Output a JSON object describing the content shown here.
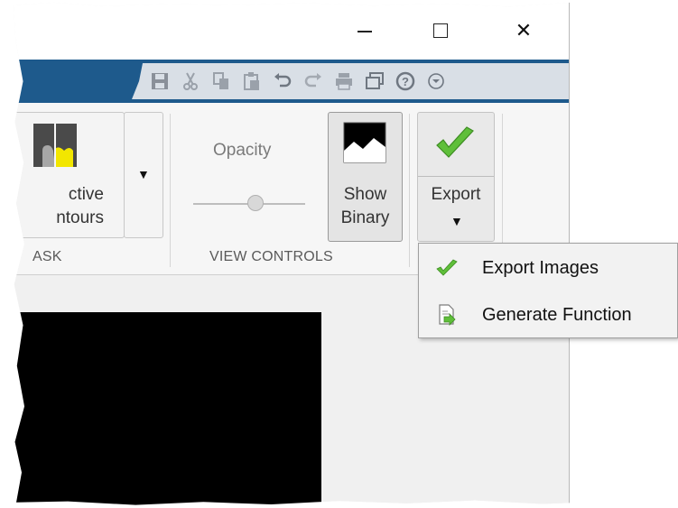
{
  "window": {
    "minimize_label": "—",
    "maximize_label": "☐",
    "close_label": "✕"
  },
  "quick_access": {
    "icons": [
      "save-icon",
      "cut-icon",
      "copy-icon",
      "paste-icon",
      "undo-icon",
      "redo-icon",
      "print-icon",
      "window-icon",
      "help-icon",
      "options-icon"
    ]
  },
  "ribbon": {
    "mask_section": {
      "active_contours_line1": "ctive",
      "active_contours_line2": "ntours",
      "label": "ASK"
    },
    "view_controls": {
      "opacity_label": "Opacity",
      "opacity_value": 0.55,
      "show_binary_line1": "Show",
      "show_binary_line2": "Binary",
      "label": "VIEW CONTROLS"
    },
    "export": {
      "label": "Export"
    }
  },
  "export_menu": {
    "items": [
      {
        "label": "Export Images",
        "icon": "check-icon"
      },
      {
        "label": "Generate Function",
        "icon": "generate-function-icon"
      }
    ]
  },
  "colors": {
    "ribbon_blue": "#1e5a8c",
    "check_green": "#5fbf3a",
    "mask_yellow": "#f2e600"
  }
}
